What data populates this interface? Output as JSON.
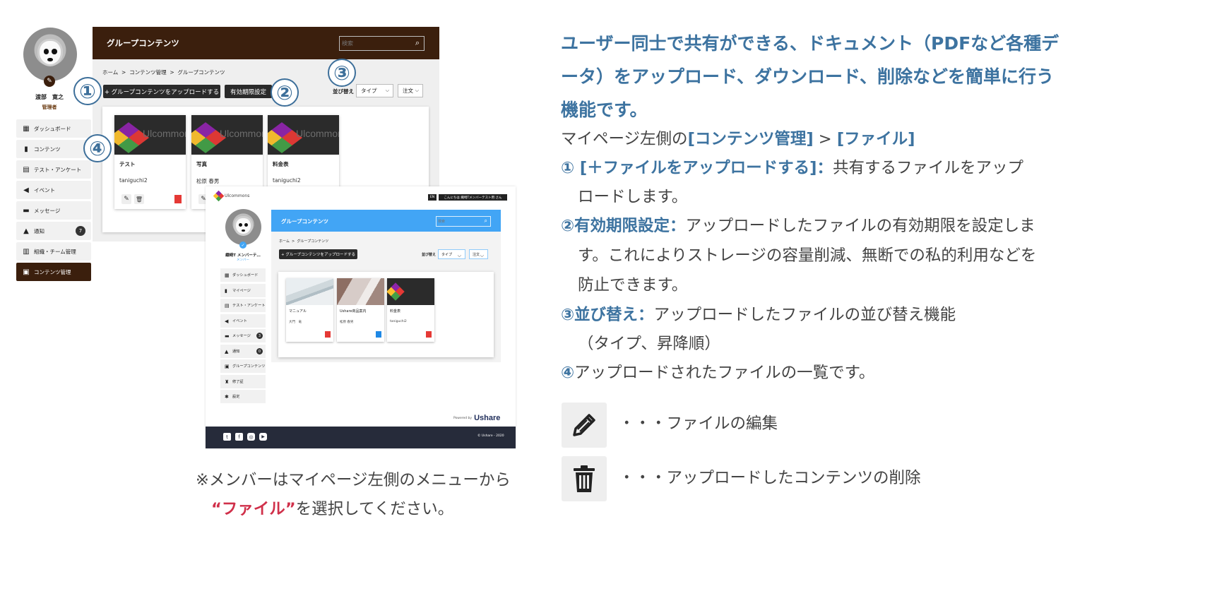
{
  "admin": {
    "user_name": "渡部　寛之",
    "user_role": "管理者",
    "sidebar": [
      {
        "label": "ダッシュボード",
        "icon": "dashboard-icon"
      },
      {
        "label": "コンテンツ",
        "icon": "book-icon"
      },
      {
        "label": "テスト・アンケート",
        "icon": "test-icon"
      },
      {
        "label": "イベント",
        "icon": "megaphone-icon"
      },
      {
        "label": "メッセージ",
        "icon": "chat-icon"
      },
      {
        "label": "通知",
        "icon": "bell-icon",
        "badge": "7"
      },
      {
        "label": "組織・チーム管理",
        "icon": "team-icon"
      },
      {
        "label": "コンテンツ管理",
        "icon": "content-manage-icon",
        "active": true
      }
    ],
    "header_title": "グループコンテンツ",
    "search_placeholder": "検索",
    "breadcrumb": "ホーム  >  コンテンツ管理  >  グループコンテンツ",
    "upload_button": "+ グループコンテンツをアップロードする",
    "expiry_button": "有効期限設定",
    "sort_label": "並び替え",
    "sort_type": "タイプ",
    "sort_order": "注文",
    "logo_text": "Ulcommons",
    "cards": [
      {
        "title": "テスト",
        "owner": "taniguchi2"
      },
      {
        "title": "写真",
        "owner": "松原 春男"
      },
      {
        "title": "料金表",
        "owner": "taniguchi2"
      }
    ],
    "callouts": [
      "①",
      "②",
      "③",
      "④"
    ]
  },
  "member": {
    "logo_text": "Ulcommons",
    "lang": "EN",
    "greeting": "こんにちは 織崎Tメンバーテスト用 さん",
    "user_name": "織崎T メンバーテ…",
    "user_role": "メンバー",
    "sidebar": [
      {
        "label": "ダッシュボード",
        "icon": "dashboard-icon"
      },
      {
        "label": "マイページ",
        "icon": "book-icon"
      },
      {
        "label": "テスト・アンケート",
        "icon": "test-icon"
      },
      {
        "label": "イベント",
        "icon": "megaphone-icon"
      },
      {
        "label": "メッセージ",
        "icon": "chat-icon",
        "badge": "3"
      },
      {
        "label": "通知",
        "icon": "bell-icon",
        "badge": "0"
      },
      {
        "label": "グループコンテンツ",
        "icon": "content-icon"
      },
      {
        "label": "修了証",
        "icon": "certificate-icon"
      },
      {
        "label": "設定",
        "icon": "gear-icon"
      }
    ],
    "header_title": "グループコンテンツ",
    "search_placeholder": "検索",
    "breadcrumb": "ホーム  >  グループコンテンツ",
    "upload_button": "+ グループコンテンツをアップロードする",
    "sort_label": "並び替え",
    "sort_type": "タイプ",
    "sort_order": "注文",
    "cards": [
      {
        "title": "マニュアル",
        "owner": "大門　竜"
      },
      {
        "title": "Ushare商品案内",
        "owner": "松原 春男"
      },
      {
        "title": "料金表",
        "owner": "taniguchi2"
      }
    ],
    "powered_by": "Powered by",
    "brand": "Ushare",
    "copyright": "© Ushare - 2020"
  },
  "note": {
    "line1": "※メンバーはマイページ左側のメニューから",
    "open_quote": "“",
    "keyword": "ファイル",
    "close_quote": "”",
    "line2_rest": "を選択してください。"
  },
  "right": {
    "heading": "ユーザー同士で共有ができる、ドキュメント（PDFなど各種データ）をアップロード、ダウンロード、削除などを簡単に行う機能です。",
    "path_prefix": "マイページ左側の",
    "path_a": "[コンテンツ管理]",
    "path_sep": " > ",
    "path_b": "[ファイル]",
    "item1_label": "① [＋ファイルをアップロードする]：",
    "item1_text": "共有するファイルをアップ",
    "item1_cont": "ロードします。",
    "item2_label": "②有効期限設定：",
    "item2_text": "アップロードしたファイルの有効期限を設定しま",
    "item2_cont1": "す。これによりストレージの容量削減、無断での私的利用などを",
    "item2_cont2": "防止できます。",
    "item3_label": "③並び替え：",
    "item3_text": "アップロードしたファイルの並び替え機能",
    "item3_cont": "（タイプ、昇降順）",
    "item4_label": "④",
    "item4_text": "アップロードされたファイルの一覧です。",
    "legend_edit": "・・・ファイルの編集",
    "legend_delete": "・・・アップロードしたコンテンツの削除"
  },
  "colors": {
    "admin_header": "#3b1f0d",
    "member_header": "#42a5f5",
    "accent_blue": "#3d73a0",
    "note_red": "#d0304a"
  }
}
